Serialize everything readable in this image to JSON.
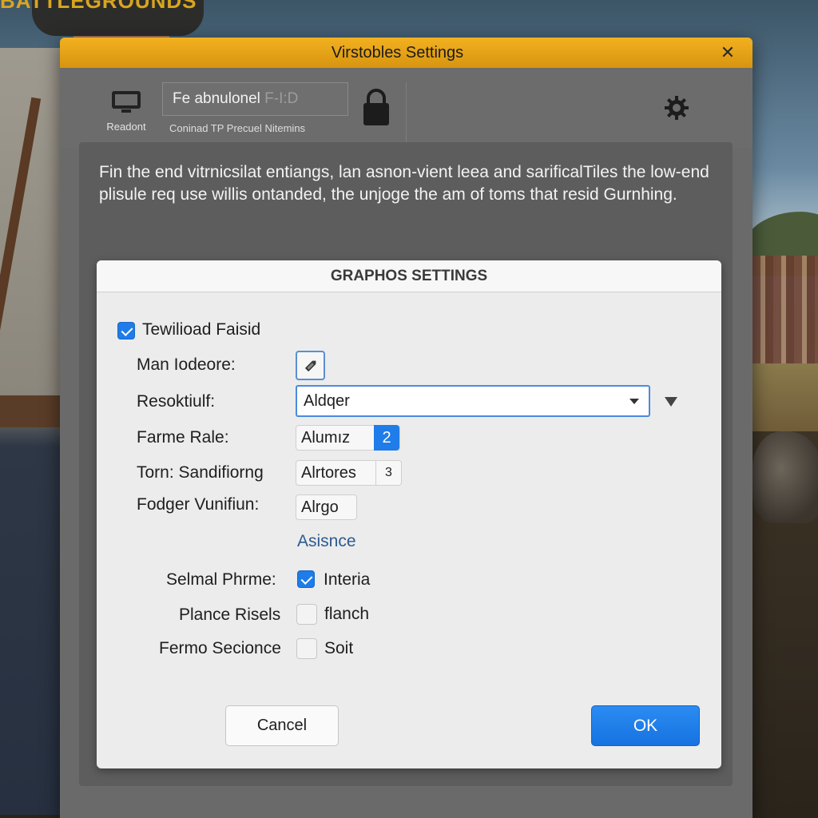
{
  "background": {
    "title_art": "BATTLEGROUNDS"
  },
  "window": {
    "title": "Virstobles Settings",
    "close_glyph": "✕",
    "toolbar": {
      "monitor_label": "Readont",
      "field_value": "Fe abnulonel",
      "field_suffix": "F-I:D",
      "field_description": "Coninad TP Precuel Nitemins",
      "icons": [
        "monitor-icon",
        "lock-icon",
        "gear-icon"
      ]
    },
    "intro_text": "Fin the end vitrnicsilat entiangs, lan asnon-vient leea and sarificalTiles the low-end plisule req use willis ontanded, the unjoge the am of toms that resid Gurnhing."
  },
  "dialog": {
    "title": "GRAPHOS SETTINGS",
    "top_checkbox": {
      "label": "Tewilioad Faisid",
      "checked": true
    },
    "rows": {
      "man_iodeore": {
        "label": "Man Iodeore:",
        "icon": "pencil-icon"
      },
      "resolution": {
        "label": "Resoktiulf:",
        "value": "Aldqer"
      },
      "frame_rate": {
        "label": "Farme Rale:",
        "value": "Alumız",
        "number": "2"
      },
      "torn_sandifiorng": {
        "label": "Torn: Sandifiorng",
        "value": "Alrtores",
        "number": "3"
      },
      "fodger_vunifiun": {
        "label": "Fodger Vunifiun:",
        "value": "Alrgo"
      }
    },
    "link_text": "Asisnce",
    "checkbox_rows": [
      {
        "label": "Selmal Phrme:",
        "option": "Interia",
        "checked": true
      },
      {
        "label": "Plance Risels",
        "option": "flanch",
        "checked": false
      },
      {
        "label": "Fermo Secionce",
        "option": "Soit",
        "checked": false
      }
    ],
    "buttons": {
      "cancel": "Cancel",
      "ok": "OK"
    }
  },
  "colors": {
    "titlebar": "#e8a317",
    "accent_blue": "#1f7ce8",
    "dialog_bg": "#ececec",
    "window_bg": "#6a6a6a"
  }
}
